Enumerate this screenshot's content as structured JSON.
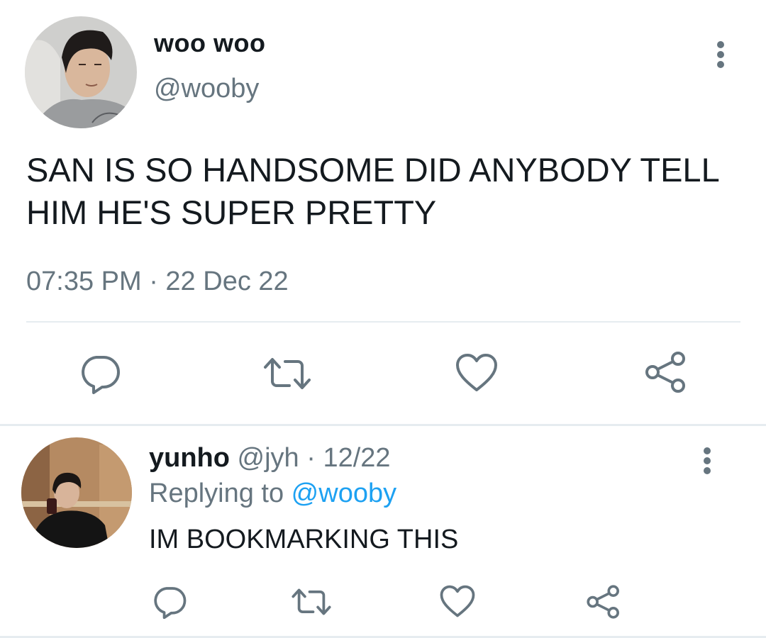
{
  "main_tweet": {
    "display_name": "woo woo",
    "handle": "@wooby",
    "text": "SAN IS SO HANDSOME DID ANYBODY TELL HIM HE'S SUPER PRETTY",
    "timestamp": "07:35 PM · 22 Dec 22",
    "icons": {
      "reply": "reply-icon",
      "retweet": "retweet-icon",
      "like": "heart-icon",
      "share": "share-icon",
      "more": "more-vertical-icon"
    }
  },
  "reply_tweet": {
    "display_name": "yunho",
    "meta": " @jyh · 12/22",
    "replying_prefix": "Replying to ",
    "replying_mention": "@wooby",
    "text": "IM BOOKMARKING THIS"
  },
  "colors": {
    "text_primary": "#141a1f",
    "text_secondary": "#66757f",
    "link": "#1da1f2",
    "divider": "#e6ecf0"
  }
}
